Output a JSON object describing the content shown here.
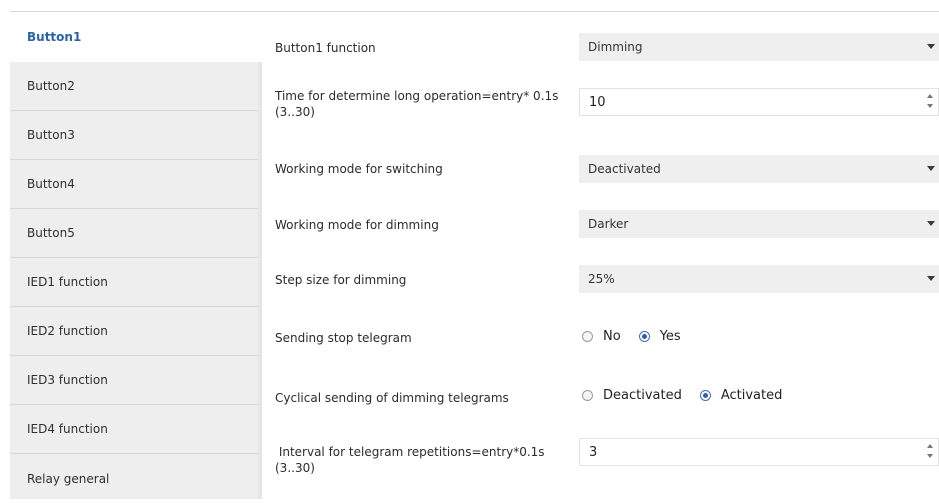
{
  "sidebar": {
    "items": [
      {
        "label": "Button1",
        "active": true
      },
      {
        "label": "Button2"
      },
      {
        "label": "Button3"
      },
      {
        "label": "Button4"
      },
      {
        "label": "Button5"
      },
      {
        "label": "IED1 function"
      },
      {
        "label": "IED2 function"
      },
      {
        "label": "IED3 function"
      },
      {
        "label": "IED4 function"
      },
      {
        "label": "Relay general"
      }
    ]
  },
  "params": {
    "function": {
      "label": "Button1 function",
      "value": "Dimming"
    },
    "long_op": {
      "label_line1": "Time for determine long operation=entry* 0.1s",
      "label_line2": "(3..30)",
      "value": "10"
    },
    "switching": {
      "label": "Working mode for switching",
      "value": "Deactivated"
    },
    "dimming": {
      "label": "Working mode for dimming",
      "value": "Darker"
    },
    "step": {
      "label": "Step size for dimming",
      "value": "25%"
    },
    "stop": {
      "label": "Sending stop telegram",
      "options": [
        "No",
        "Yes"
      ],
      "selected": "Yes"
    },
    "cyclical": {
      "label": "Cyclical sending of dimming telegrams",
      "options": [
        "Deactivated",
        "Activated"
      ],
      "selected": "Activated"
    },
    "interval": {
      "label_line1": " Interval for telegram repetitions=entry*0.1s",
      "label_line2": "(3..30)",
      "value": "3"
    }
  }
}
